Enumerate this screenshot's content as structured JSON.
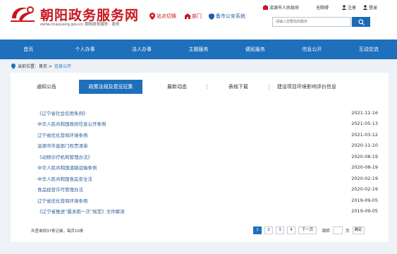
{
  "header": {
    "site_title": "朝阳政务服务网",
    "site_sub": "zwfw.chaoyang.gov.cn  朝阳政务服务 · 政务",
    "links": {
      "site_switch": "站点切换",
      "department": "部门",
      "records": "备市公安系统"
    },
    "top_right": {
      "gov": "凌源市人民政府",
      "accessibility": "无障碍",
      "register": "注册",
      "login": "登录"
    },
    "search_placeholder": "请输入您要找的服务"
  },
  "nav": [
    "首页",
    "个人办事",
    "法人办事",
    "主题服务",
    "便民服务",
    "信息公开",
    "互动交流"
  ],
  "breadcrumb": {
    "prefix": "当前位置：首页 >",
    "current": "信息公开"
  },
  "tabs": [
    "通知公告",
    "政策法规及意见征集",
    "最新动态",
    "表格下载",
    "建设项目环境影响评价信息"
  ],
  "active_tab": "政策法规及意见征集",
  "items": [
    {
      "title": "《辽宁省社会信用条例》",
      "date": "2021-12-16"
    },
    {
      "title": "中华人民共和国政府信息公开条例",
      "date": "2021-05-13"
    },
    {
      "title": "辽宁省优化营商环境条例",
      "date": "2021-03-12"
    },
    {
      "title": "凌源市市直部门权责清单",
      "date": "2020-11-10"
    },
    {
      "title": "《动物诊疗机构管理办法》",
      "date": "2020-08-19"
    },
    {
      "title": "中华人民共和国道路运输条例",
      "date": "2020-08-19"
    },
    {
      "title": "中华人民共和国食品安全法",
      "date": "2020-02-19"
    },
    {
      "title": "食品经营许可管理办法",
      "date": "2020-02-19"
    },
    {
      "title": "辽宁省优化营商环境条例",
      "date": "2019-09-05"
    },
    {
      "title": "《辽宁省推进“最多跑一次”规定》文件解读",
      "date": "2019-09-05"
    }
  ],
  "pager": {
    "info": "共查询到37条记录，每页10条",
    "pages": [
      "1",
      "2",
      "3",
      "4"
    ],
    "current": "1",
    "next": "下一页",
    "goto_label": "跳转",
    "page_unit": "页",
    "confirm": "确定"
  },
  "colors": {
    "brand_red": "#c8161e",
    "nav_blue": "#1e6fbc",
    "link_blue": "#2d5f9a"
  }
}
